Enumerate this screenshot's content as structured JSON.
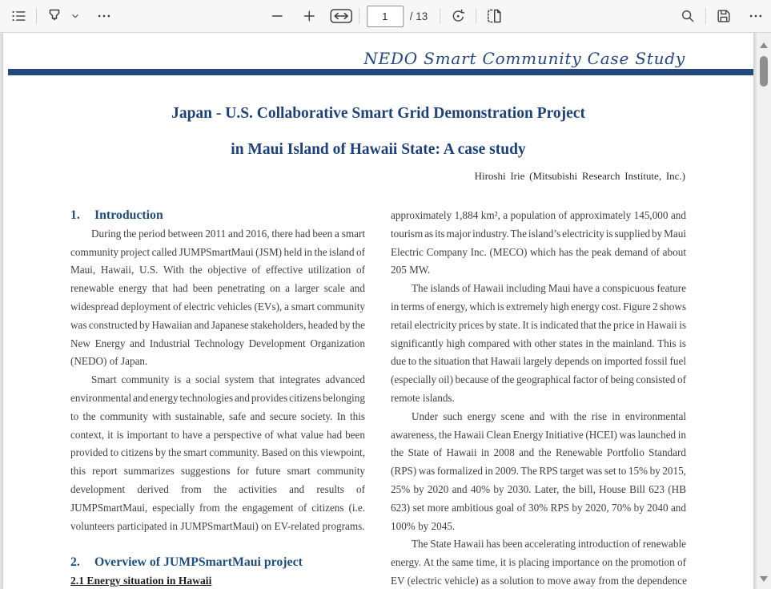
{
  "colors": {
    "accent_blue": "#24497c",
    "heading_blue": "#1f4e79",
    "title_blue": "#1e4175",
    "body_text": "#3f3f3f",
    "toolbar_bg": "#f7f7f7"
  },
  "toolbar": {
    "page_input": "1",
    "page_count_label": "/ 13",
    "icons": [
      "table-of-contents-icon",
      "highlighter-pen-icon",
      "chevron-down-icon",
      "more-tools-icon",
      "zoom-out-icon",
      "zoom-in-icon",
      "fit-to-width-icon",
      "rotate-icon",
      "page-view-icon",
      "search-icon",
      "save-icon",
      "more-options-icon",
      "scroll-up-icon",
      "scroll-down-icon"
    ]
  },
  "document": {
    "header_script": "NEDO Smart Community Case Study",
    "title_line1": "Japan - U.S. Collaborative Smart Grid Demonstration Project",
    "title_line2": "in Maui Island of Hawaii State: A case study",
    "author": "Hiroshi Irie (Mitsubishi Research Institute, Inc.)",
    "left_column": [
      {
        "type": "heading",
        "number": "1.",
        "text": "Introduction"
      },
      {
        "type": "para",
        "indent": true,
        "lines": [
          "During the period between 2011 and 2016, there had been a smart",
          "community project called JUMPSmartMaui (JSM) held in the island of",
          "Maui, Hawaii, U.S. With the objective of effective utilization of",
          "renewable energy that had been penetrating on a larger scale and",
          "widespread deployment of electric vehicles (EVs), a smart community",
          "was constructed by Hawaiian and Japanese stakeholders, headed by the",
          "New Energy and Industrial Technology Development Organization",
          "(NEDO) of Japan."
        ]
      },
      {
        "type": "para",
        "indent": true,
        "lines": [
          "Smart community is a social system that integrates advanced",
          "environmental and energy technologies and provides citizens belonging",
          "to the community with sustainable, safe and secure society. In this",
          "context, it is important to have a perspective of what value had been",
          "provided to citizens by the smart community. Based on this viewpoint,",
          "this report summarizes suggestions for future smart community",
          "development derived from the activities and results of",
          "JUMPSmartMaui, especially from the engagement of citizens (i.e.",
          "volunteers participated in JUMPSmartMaui) on EV-related programs."
        ]
      },
      {
        "type": "spacer"
      },
      {
        "type": "heading",
        "number": "2.",
        "text": "Overview of JUMPSmartMaui project"
      },
      {
        "type": "subheading",
        "text": "2.1 Energy situation in Hawaii"
      }
    ],
    "right_column": [
      {
        "type": "para",
        "indent": false,
        "lines": [
          "approximately 1,884 km², a population of approximately 145,000 and",
          "tourism as its major industry. The island’s electricity is supplied by Maui",
          "Electric Company Inc. (MECO) which has the peak demand of about",
          "205 MW."
        ]
      },
      {
        "type": "para",
        "indent": true,
        "lines": [
          "The islands of Hawaii including Maui have a conspicuous feature",
          "in terms of energy, which is extremely high energy cost. Figure 2 shows",
          "retail electricity prices by state. It is indicated that the price in Hawaii is",
          "significantly high compared with other states in the mainland. This is",
          "due to the situation that Hawaii largely depends on imported fossil fuel",
          "(especially oil) because of the geographical factor of being consisted of",
          "remote islands."
        ]
      },
      {
        "type": "para",
        "indent": true,
        "lines": [
          "Under such energy scene and with the rise in environmental",
          "awareness, the Hawaii Clean Energy Initiative (HCEI) was launched in",
          "the State of Hawaii in 2008 and the Renewable Portfolio Standard",
          "(RPS) was formalized in 2009. The RPS target was set to 15% by 2015,",
          "25% by 2020 and 40% by 2030. Later, the bill, House Bill 623 (HB",
          "623) set more ambitious goal of 30% RPS by 2020, 70% by 2040 and",
          "100% by 2045."
        ]
      },
      {
        "type": "para",
        "indent": true,
        "lines": [
          "The State Hawaii has been accelerating introduction of renewable",
          "energy. At the same time, it is placing importance on the promotion of",
          "EV (electric vehicle) as a solution to move away from the dependence",
          ""
        ]
      }
    ]
  }
}
